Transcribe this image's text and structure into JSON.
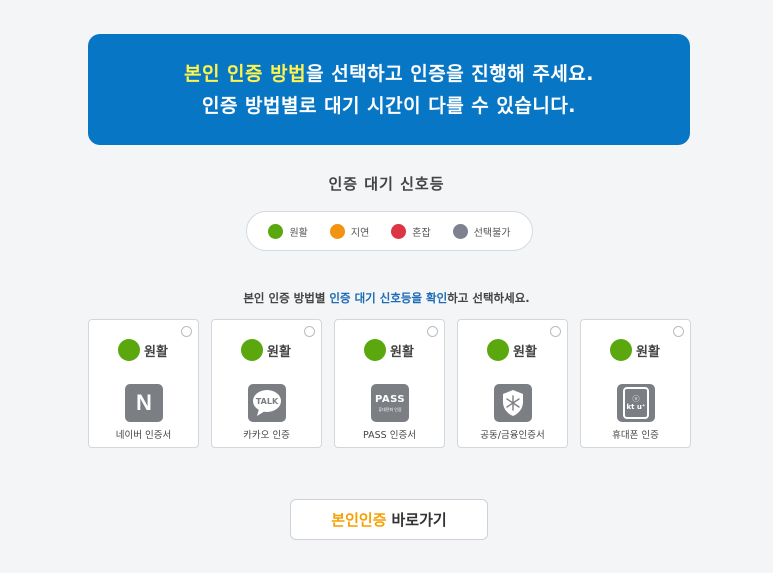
{
  "banner": {
    "line1_highlight": "본인 인증 방법",
    "line1_rest": "을 선택하고 인증을 진행해 주세요.",
    "line2": "인증 방법별로 대기 시간이 다를 수 있습니다."
  },
  "signal_title": "인증 대기 신호등",
  "legend": [
    {
      "label": "원활",
      "color": "#5aa70e"
    },
    {
      "label": "지연",
      "color": "#f39312"
    },
    {
      "label": "혼잡",
      "color": "#dc3545"
    },
    {
      "label": "선택불가",
      "color": "#7e8290"
    }
  ],
  "instruction": {
    "part1": "본인 인증 방법별 ",
    "highlight": "인증 대기 신호등을 확인",
    "part2": "하고 선택하세요."
  },
  "cards": [
    {
      "status": "원활",
      "status_color": "#5aa70e",
      "icon": "naver-icon",
      "icon_text": "N",
      "label": "네이버 인증서"
    },
    {
      "status": "원활",
      "status_color": "#5aa70e",
      "icon": "kakao-talk-icon",
      "icon_text": "TALK",
      "label": "카카오 인증"
    },
    {
      "status": "원활",
      "status_color": "#5aa70e",
      "icon": "pass-icon",
      "icon_text": "PASS",
      "icon_subtext": "휴대전화 인증",
      "label": "PASS 인증서"
    },
    {
      "status": "원활",
      "status_color": "#5aa70e",
      "icon": "shield-certificate-icon",
      "label": "공동/금융인증서"
    },
    {
      "status": "원활",
      "status_color": "#5aa70e",
      "icon": "kt-mobile-phone-icon",
      "icon_text": "kt u⁺",
      "label": "휴대폰 인증"
    }
  ],
  "go_button": {
    "highlight": "본인인증",
    "rest": "바로가기"
  }
}
